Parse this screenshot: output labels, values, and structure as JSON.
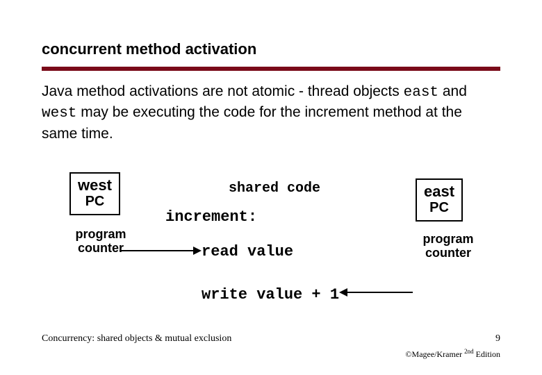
{
  "title": "concurrent method activation",
  "body": {
    "p1a": "Java method activations are not atomic - thread objects ",
    "east": "east",
    "p1b": " and ",
    "west": "west",
    "p1c": " may be executing the code for the increment method at the same time."
  },
  "pc": {
    "west_label": "west",
    "east_label": "east",
    "sub": "PC",
    "caption1": "program",
    "caption2": "counter"
  },
  "code": {
    "shared": "shared code",
    "increment": "increment:",
    "read": "read value",
    "write": "write value + 1"
  },
  "footer": {
    "left": "Concurrency: shared objects & mutual exclusion",
    "page": "9",
    "cite_pre": "©Magee/Kramer ",
    "cite_sup": "2nd",
    "cite_post": " Edition"
  }
}
